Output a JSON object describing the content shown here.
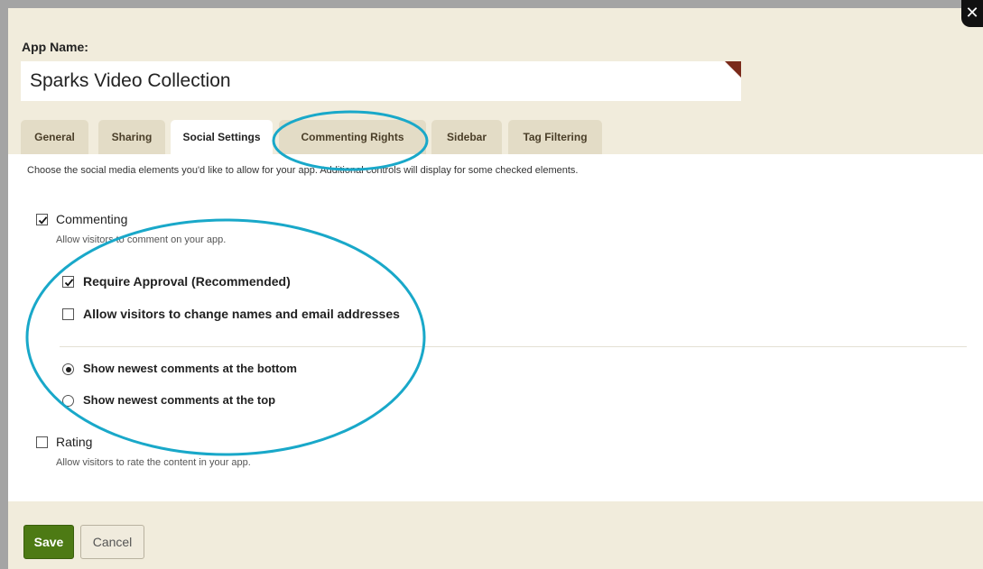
{
  "close_icon": "close-icon",
  "app_name": {
    "label": "App Name:",
    "value": "Sparks Video Collection"
  },
  "tabs": [
    {
      "label": "General",
      "active": false
    },
    {
      "label": "Sharing",
      "active": false
    },
    {
      "label": "Social Settings",
      "active": true
    },
    {
      "label": "Commenting Rights",
      "active": false
    },
    {
      "label": "Sidebar",
      "active": false
    },
    {
      "label": "Tag Filtering",
      "active": false
    }
  ],
  "social": {
    "description": "Choose the social media elements you'd like to allow for your app. Additional controls will display for some checked elements.",
    "commenting": {
      "label": "Commenting",
      "description": "Allow visitors to comment on your app.",
      "checked": true,
      "require_approval": {
        "label": "Require Approval (Recommended)",
        "checked": true
      },
      "allow_change_names": {
        "label": "Allow visitors to change names and email addresses",
        "checked": false
      },
      "sort_options": [
        {
          "label": "Show newest comments at the bottom",
          "selected": true
        },
        {
          "label": "Show newest comments at the top",
          "selected": false
        }
      ]
    },
    "rating": {
      "label": "Rating",
      "description": "Allow visitors to rate the content in your app.",
      "checked": false
    }
  },
  "footer": {
    "save_label": "Save",
    "cancel_label": "Cancel"
  },
  "colors": {
    "save_button": "#4d7a14",
    "annotation_circle": "#19a8c9",
    "background": "#f1ecdc"
  }
}
